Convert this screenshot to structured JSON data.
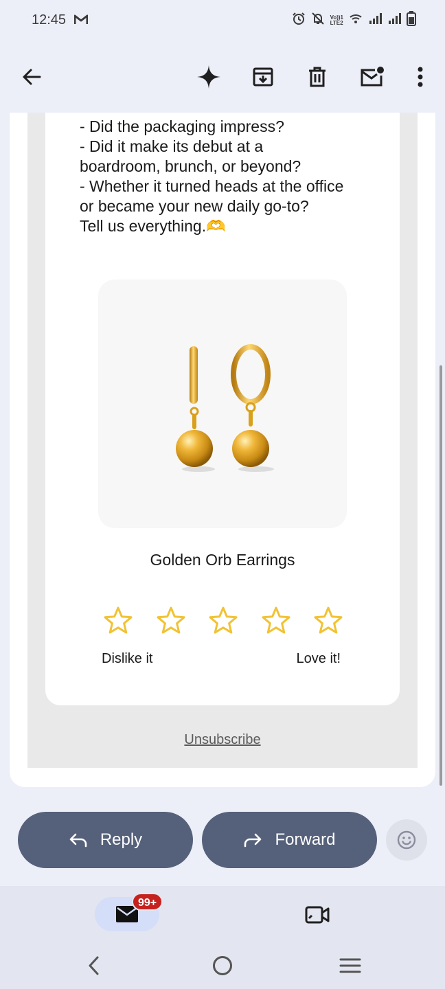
{
  "status_bar": {
    "time": "12:45",
    "app_icon": "gmail-m-icon",
    "network_label_1": "Vo))1",
    "network_label_2": "LTE2",
    "icons": [
      "alarm-icon",
      "bell-off-icon",
      "wifi-icon",
      "signal-icon",
      "battery-icon"
    ]
  },
  "toolbar": {
    "icons": [
      "back-arrow-icon",
      "gemini-sparkle-icon",
      "archive-icon",
      "trash-icon",
      "mark-unread-icon",
      "more-vert-icon"
    ]
  },
  "email": {
    "body_lines": [
      "- Did the packaging impress?",
      "- Did it make its debut at a",
      "boardroom, brunch, or beyond?",
      "- Whether it turned heads at the office",
      "or became your new daily go-to?",
      "Tell us everything.🫶"
    ],
    "product_name": "Golden Orb Earrings",
    "product_image": "gold-ball-drop-hoop-earrings",
    "rating": {
      "star_count": 5,
      "low_label": "Dislike it",
      "high_label": "Love it!"
    },
    "unsubscribe_label": "Unsubscribe"
  },
  "actions": {
    "reply_label": "Reply",
    "forward_label": "Forward",
    "emoji_icon": "emoji-reaction-icon"
  },
  "bottom_nav": {
    "mail_badge": "99+",
    "tabs": [
      "mail-icon",
      "meet-video-icon"
    ]
  },
  "system_nav": [
    "recents-back-icon",
    "home-icon",
    "menu-icon"
  ],
  "colors": {
    "star": "#f1c232",
    "action_button": "#55607a",
    "badge": "#c5221f",
    "gold": "#d9a019"
  }
}
